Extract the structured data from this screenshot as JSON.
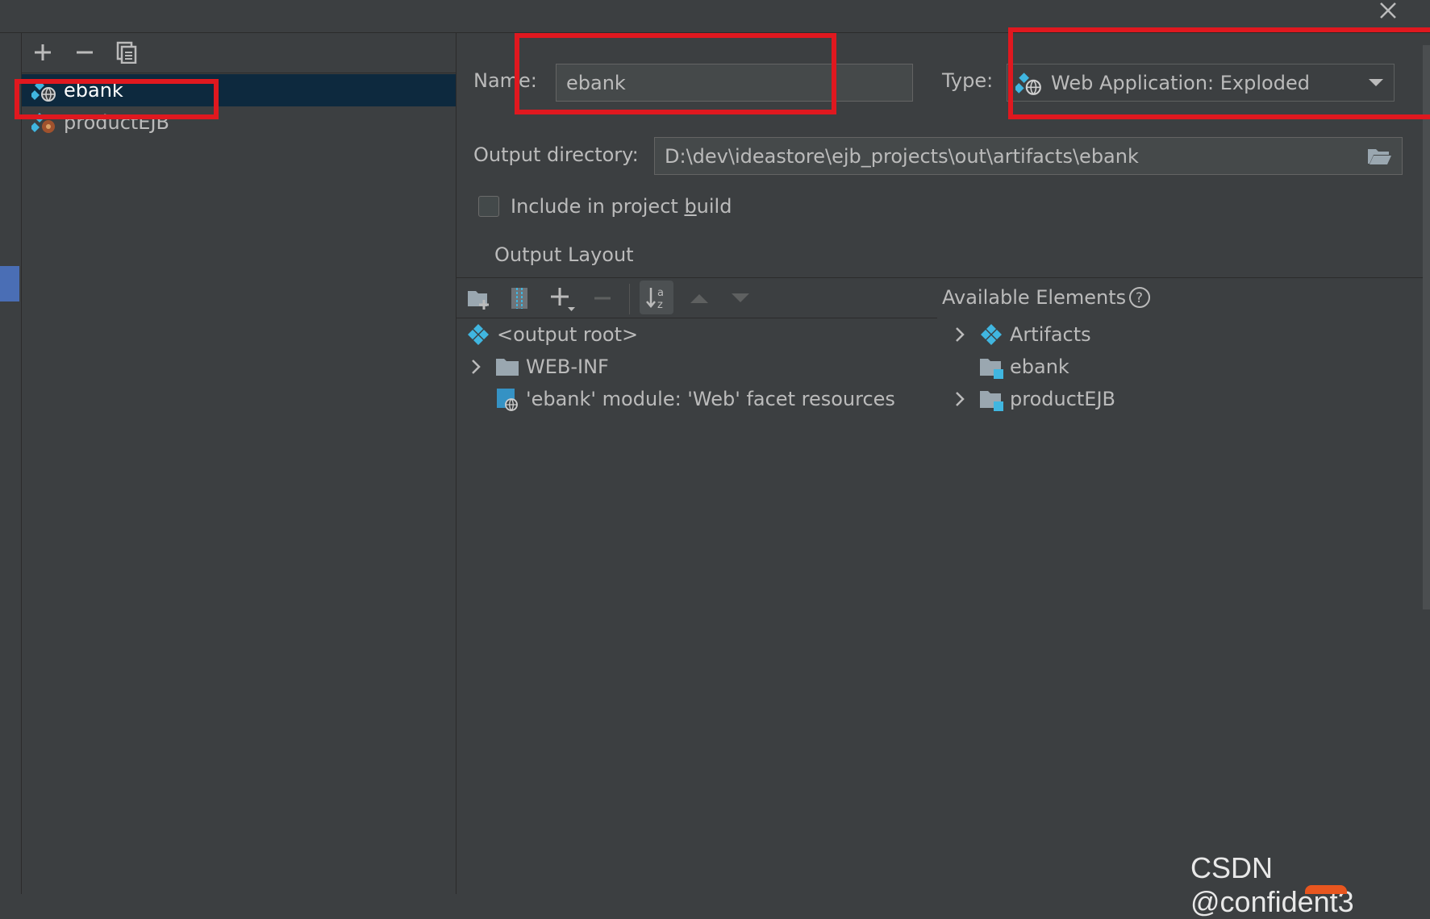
{
  "toolbar": {
    "add_icon": "plus-icon",
    "remove_icon": "minus-icon",
    "copy_icon": "copy-icon"
  },
  "artifacts": [
    {
      "label": "ebank",
      "icon": "web-artifact-icon",
      "selected": true
    },
    {
      "label": "productEJB",
      "icon": "ejb-artifact-icon",
      "selected": false
    }
  ],
  "form": {
    "name_label": "Name:",
    "name_value": "ebank",
    "type_label": "Type:",
    "type_value": "Web Application: Exploded",
    "output_dir_label": "Output directory:",
    "output_dir_value": "D:\\dev\\ideastore\\ejb_projects\\out\\artifacts\\ebank",
    "include_build_label_pre": "Include in project ",
    "include_build_label_mnemonic": "b",
    "include_build_label_post": "uild",
    "include_build_checked": false
  },
  "output_layout": {
    "tab_label": "Output Layout",
    "tree": [
      {
        "label": "<output root>",
        "icon": "output-root-icon",
        "expandable": false
      },
      {
        "label": "WEB-INF",
        "icon": "folder-icon",
        "expandable": true
      },
      {
        "label": "'ebank' module: 'Web' facet resources",
        "icon": "web-facet-icon",
        "expandable": false
      }
    ]
  },
  "available_elements": {
    "title": "Available Elements",
    "tree": [
      {
        "label": "Artifacts",
        "icon": "artifacts-icon",
        "expandable": true
      },
      {
        "label": "ebank",
        "icon": "module-folder-icon",
        "expandable": false
      },
      {
        "label": "productEJB",
        "icon": "module-folder-icon",
        "expandable": true
      }
    ]
  },
  "watermark": "CSDN @confident3",
  "colors": {
    "background": "#3c3f41",
    "selection": "#0d293e",
    "highlight_box": "#e0181f",
    "accent_blue": "#40b6e0"
  }
}
